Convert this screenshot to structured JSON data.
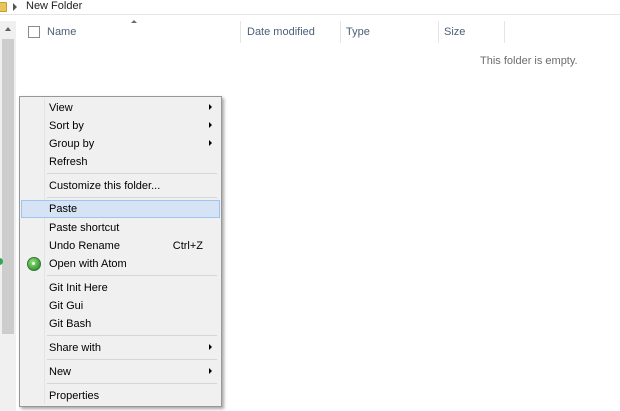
{
  "breadcrumb": {
    "folder_name": "New Folder"
  },
  "columns": {
    "name": "Name",
    "date_modified": "Date modified",
    "type": "Type",
    "size": "Size"
  },
  "empty_message": "This folder is empty.",
  "context_menu": {
    "view": "View",
    "sort_by": "Sort by",
    "group_by": "Group by",
    "refresh": "Refresh",
    "customize": "Customize this folder...",
    "paste": "Paste",
    "paste_shortcut": "Paste shortcut",
    "undo_rename": "Undo Rename",
    "undo_rename_shortcut": "Ctrl+Z",
    "open_with_atom": "Open with Atom",
    "git_init_here": "Git Init Here",
    "git_gui": "Git Gui",
    "git_bash": "Git Bash",
    "share_with": "Share with",
    "new": "New",
    "properties": "Properties"
  },
  "colors": {
    "highlight_bg": "#d5e3f5",
    "highlight_border": "#9ec5ee",
    "header_text": "#4c607a",
    "menu_bg": "#f0f0f0"
  }
}
